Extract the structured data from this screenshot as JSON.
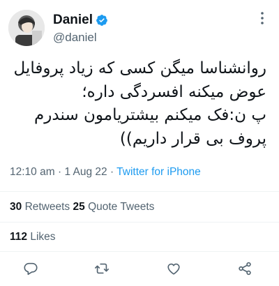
{
  "author": {
    "display_name": "Daniel",
    "handle": "@daniel",
    "verified": true,
    "avatar_icon": "profile-photo"
  },
  "tweet": {
    "lines": [
      "روانشناسا میگن کسی که زیاد پروفایل",
      "عوض میکنه افسردگی داره؛",
      "پ ن:فک میکنم بیشتریامون سندرم",
      "پروف بی قرار داریم))"
    ]
  },
  "meta": {
    "time": "12:10 am",
    "separator": "·",
    "date": "1 Aug 22",
    "source": "Twitter for iPhone"
  },
  "stats": {
    "retweets_count": "30",
    "retweets_label": "Retweets",
    "quotes_count": "25",
    "quotes_label": "Quote Tweets",
    "likes_count": "112",
    "likes_label": "Likes"
  },
  "actions": {
    "reply_icon": "reply-icon",
    "retweet_icon": "retweet-icon",
    "like_icon": "heart-icon",
    "share_icon": "share-icon"
  },
  "colors": {
    "accent": "#1d9bf0",
    "text": "#0f1419",
    "secondary": "#536471",
    "divider": "#eff3f4"
  }
}
